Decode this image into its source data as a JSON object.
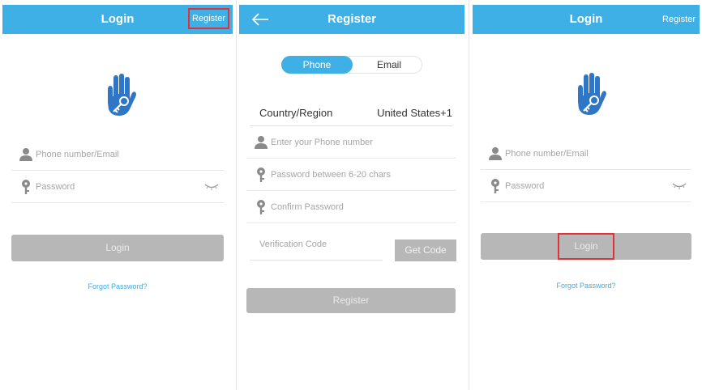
{
  "login_screen": {
    "title": "Login",
    "register_label": "Register",
    "phone_placeholder": "Phone number/Email",
    "password_placeholder": "Password",
    "login_button": "Login",
    "forgot_password": "Forgot Password?"
  },
  "register_screen": {
    "title": "Register",
    "tabs": [
      "Phone",
      "Email"
    ],
    "country_label": "Country/Region",
    "country_value": "United States+1",
    "phone_placeholder": "Enter your Phone number",
    "password_placeholder": "Password between 6-20 chars",
    "confirm_placeholder": "Confirm Password",
    "verification_placeholder": "Verification Code",
    "get_code_button": "Get Code",
    "register_button": "Register"
  },
  "login_screen_2": {
    "title": "Login",
    "register_label": "Register",
    "phone_placeholder": "Phone number/Email",
    "password_placeholder": "Password",
    "login_button": "Login",
    "forgot_password": "Forgot Password?"
  },
  "colors": {
    "header": "#3fb0e6",
    "logo": "#2f77c6",
    "button_disabled": "#b7b7b7",
    "link": "#3fa9e0",
    "highlight": "#e0323a"
  },
  "icons": [
    "hand-key-logo-icon",
    "person-icon",
    "key-icon",
    "eye-closed-icon",
    "back-arrow-icon"
  ]
}
